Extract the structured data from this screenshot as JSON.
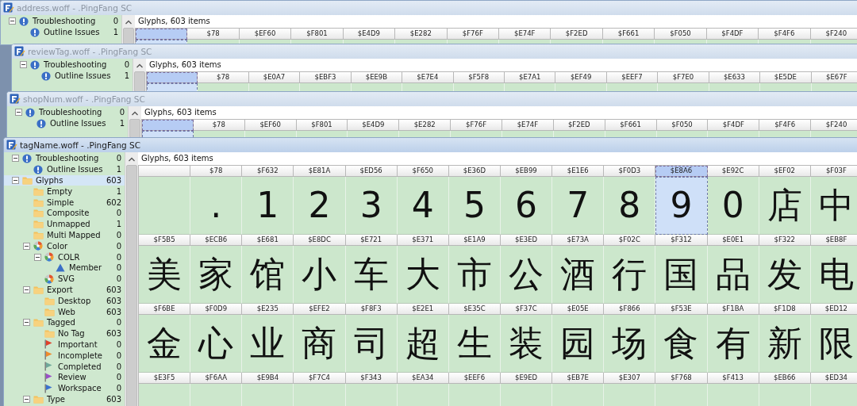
{
  "windows": [
    {
      "title": "address.woff - .PingFang SC",
      "active": false,
      "tree": [
        {
          "label": "Troubleshooting",
          "kind": "info",
          "count": "0",
          "expanded": true,
          "selected": false,
          "children": [
            {
              "label": "Outline Issues",
              "kind": "info",
              "count": "1",
              "selected": false
            }
          ]
        }
      ],
      "list_title": "Glyphs, 603 items",
      "rows": [
        {
          "cells": [
            {
              "selected": true
            },
            {
              "code": "$78",
              "selected": false
            },
            {
              "code": "$EF60",
              "selected": false
            },
            {
              "code": "$F801",
              "selected": false
            },
            {
              "code": "$E4D9",
              "selected": false
            },
            {
              "code": "$E282",
              "selected": false
            },
            {
              "code": "$F76F",
              "selected": false
            },
            {
              "code": "$E74F",
              "selected": false
            },
            {
              "code": "$F2ED",
              "selected": false
            },
            {
              "code": "$F661",
              "selected": false
            },
            {
              "code": "$F050",
              "selected": false
            },
            {
              "code": "$F4DF",
              "selected": false
            },
            {
              "code": "$F4F6",
              "selected": false
            },
            {
              "code": "$F240",
              "selected": false
            }
          ]
        }
      ]
    },
    {
      "title": "reviewTag.woff - .PingFang SC",
      "active": false,
      "tree": [
        {
          "label": "Troubleshooting",
          "kind": "info",
          "count": "0",
          "expanded": true,
          "selected": false,
          "children": [
            {
              "label": "Outline Issues",
              "kind": "info",
              "count": "1",
              "selected": false
            }
          ]
        }
      ],
      "list_title": "Glyphs, 603 items",
      "rows": [
        {
          "cells": [
            {
              "selected": true
            },
            {
              "code": "$78",
              "selected": false
            },
            {
              "code": "$E0A7",
              "selected": false
            },
            {
              "code": "$EBF3",
              "selected": false
            },
            {
              "code": "$EE9B",
              "selected": false
            },
            {
              "code": "$E7E4",
              "selected": false
            },
            {
              "code": "$F5F8",
              "selected": false
            },
            {
              "code": "$E7A1",
              "selected": false
            },
            {
              "code": "$EF49",
              "selected": false
            },
            {
              "code": "$EEF7",
              "selected": false
            },
            {
              "code": "$F7E0",
              "selected": false
            },
            {
              "code": "$E633",
              "selected": false
            },
            {
              "code": "$E5DE",
              "selected": false
            },
            {
              "code": "$E67F",
              "selected": false
            }
          ]
        }
      ]
    },
    {
      "title": "shopNum.woff - .PingFang SC",
      "active": false,
      "tree": [
        {
          "label": "Troubleshooting",
          "kind": "info",
          "count": "0",
          "expanded": true,
          "selected": false,
          "children": [
            {
              "label": "Outline Issues",
              "kind": "info",
              "count": "1",
              "selected": false
            }
          ]
        }
      ],
      "list_title": "Glyphs, 603 items",
      "rows": [
        {
          "cells": [
            {
              "selected": true
            },
            {
              "code": "$78",
              "selected": false
            },
            {
              "code": "$EF60",
              "selected": false
            },
            {
              "code": "$F801",
              "selected": false
            },
            {
              "code": "$E4D9",
              "selected": false
            },
            {
              "code": "$E282",
              "selected": false
            },
            {
              "code": "$F76F",
              "selected": false
            },
            {
              "code": "$E74F",
              "selected": false
            },
            {
              "code": "$F2ED",
              "selected": false
            },
            {
              "code": "$F661",
              "selected": false
            },
            {
              "code": "$F050",
              "selected": false
            },
            {
              "code": "$F4DF",
              "selected": false
            },
            {
              "code": "$F4F6",
              "selected": false
            },
            {
              "code": "$F240",
              "selected": false
            }
          ]
        }
      ]
    },
    {
      "title": "tagName.woff - .PingFang SC",
      "active": true,
      "tree": [
        {
          "label": "Troubleshooting",
          "kind": "info",
          "count": "0",
          "expanded": true,
          "selected": false,
          "children": [
            {
              "label": "Outline Issues",
              "kind": "info",
              "count": "1",
              "selected": false
            }
          ]
        },
        {
          "label": "Glyphs",
          "kind": "folder",
          "count": "603",
          "expanded": true,
          "selected": true,
          "children": [
            {
              "label": "Empty",
              "kind": "folder",
              "count": "1",
              "selected": false
            },
            {
              "label": "Simple",
              "kind": "folder",
              "count": "602",
              "selected": false
            },
            {
              "label": "Composite",
              "kind": "folder",
              "count": "0",
              "selected": false
            },
            {
              "label": "Unmapped",
              "kind": "folder",
              "count": "1",
              "selected": false
            },
            {
              "label": "Multi Mapped",
              "kind": "folder",
              "count": "0",
              "selected": false
            },
            {
              "label": "Color",
              "kind": "palette",
              "count": "0",
              "expanded": true,
              "selected": false,
              "children": [
                {
                  "label": "COLR",
                  "kind": "palette",
                  "count": "0",
                  "expanded": true,
                  "selected": false,
                  "children": [
                    {
                      "label": "Member",
                      "kind": "triangle",
                      "count": "0",
                      "selected": false
                    }
                  ]
                },
                {
                  "label": "SVG",
                  "kind": "palette",
                  "count": "0",
                  "selected": false
                }
              ]
            },
            {
              "label": "Export",
              "kind": "folder",
              "count": "603",
              "expanded": true,
              "selected": false,
              "children": [
                {
                  "label": "Desktop",
                  "kind": "folder",
                  "count": "603",
                  "selected": false
                },
                {
                  "label": "Web",
                  "kind": "folder",
                  "count": "603",
                  "selected": false
                }
              ]
            },
            {
              "label": "Tagged",
              "kind": "folder",
              "count": "0",
              "expanded": true,
              "selected": false,
              "children": [
                {
                  "label": "No Tag",
                  "kind": "folder",
                  "count": "603",
                  "selected": false
                },
                {
                  "label": "Important",
                  "kind": "flag",
                  "color": "#e0402a",
                  "count": "0",
                  "selected": false
                },
                {
                  "label": "Incomplete",
                  "kind": "flag",
                  "color": "#f08a2a",
                  "count": "0",
                  "selected": false
                },
                {
                  "label": "Completed",
                  "kind": "flag",
                  "color": "#6fa89a",
                  "count": "0",
                  "selected": false
                },
                {
                  "label": "Review",
                  "kind": "flag",
                  "color": "#9a4fc8",
                  "count": "0",
                  "selected": false
                },
                {
                  "label": "Workspace",
                  "kind": "flag",
                  "color": "#3a72d0",
                  "count": "0",
                  "selected": false
                }
              ]
            },
            {
              "label": "Type",
              "kind": "folder",
              "count": "603",
              "expanded": true,
              "selected": false
            }
          ]
        }
      ],
      "list_title": "Glyphs, 603 items",
      "rows": [
        {
          "cells": [
            {
              "selected": false
            },
            {
              "code": "$78",
              "glyph": ".",
              "selected": false
            },
            {
              "code": "$F632",
              "glyph": "1",
              "selected": false
            },
            {
              "code": "$E81A",
              "glyph": "2",
              "selected": false
            },
            {
              "code": "$ED56",
              "glyph": "3",
              "selected": false
            },
            {
              "code": "$F650",
              "glyph": "4",
              "selected": false
            },
            {
              "code": "$E36D",
              "glyph": "5",
              "selected": false
            },
            {
              "code": "$EB99",
              "glyph": "6",
              "selected": false
            },
            {
              "code": "$E1E6",
              "glyph": "7",
              "selected": false
            },
            {
              "code": "$F0D3",
              "glyph": "8",
              "selected": false
            },
            {
              "code": "$E8A6",
              "glyph": "9",
              "selected": true
            },
            {
              "code": "$E92C",
              "glyph": "0",
              "selected": false
            },
            {
              "code": "$EF02",
              "glyph": "店",
              "selected": false
            },
            {
              "code": "$F03F",
              "glyph": "中",
              "selected": false
            }
          ]
        },
        {
          "cells": [
            {
              "code": "$F5B5",
              "glyph": "美",
              "selected": false
            },
            {
              "code": "$ECB6",
              "glyph": "家",
              "selected": false
            },
            {
              "code": "$E681",
              "glyph": "馆",
              "selected": false
            },
            {
              "code": "$E8DC",
              "glyph": "小",
              "selected": false
            },
            {
              "code": "$E721",
              "glyph": "车",
              "selected": false
            },
            {
              "code": "$E371",
              "glyph": "大",
              "selected": false
            },
            {
              "code": "$E1A9",
              "glyph": "市",
              "selected": false
            },
            {
              "code": "$E3ED",
              "glyph": "公",
              "selected": false
            },
            {
              "code": "$E73A",
              "glyph": "酒",
              "selected": false
            },
            {
              "code": "$F02C",
              "glyph": "行",
              "selected": false
            },
            {
              "code": "$F312",
              "glyph": "国",
              "selected": false
            },
            {
              "code": "$E0E1",
              "glyph": "品",
              "selected": false
            },
            {
              "code": "$F322",
              "glyph": "发",
              "selected": false
            },
            {
              "code": "$EB8F",
              "glyph": "电",
              "selected": false
            }
          ]
        },
        {
          "cells": [
            {
              "code": "$F6BE",
              "glyph": "金",
              "selected": false
            },
            {
              "code": "$F0D9",
              "glyph": "心",
              "selected": false
            },
            {
              "code": "$E235",
              "glyph": "业",
              "selected": false
            },
            {
              "code": "$EFE2",
              "glyph": "商",
              "selected": false
            },
            {
              "code": "$F8F3",
              "glyph": "司",
              "selected": false
            },
            {
              "code": "$E2E1",
              "glyph": "超",
              "selected": false
            },
            {
              "code": "$E35C",
              "glyph": "生",
              "selected": false
            },
            {
              "code": "$F37C",
              "glyph": "装",
              "selected": false
            },
            {
              "code": "$E05E",
              "glyph": "园",
              "selected": false
            },
            {
              "code": "$F866",
              "glyph": "场",
              "selected": false
            },
            {
              "code": "$F53E",
              "glyph": "食",
              "selected": false
            },
            {
              "code": "$F1BA",
              "glyph": "有",
              "selected": false
            },
            {
              "code": "$F1D8",
              "glyph": "新",
              "selected": false
            },
            {
              "code": "$ED12",
              "glyph": "限",
              "selected": false
            }
          ]
        },
        {
          "cells": [
            {
              "code": "$E3F5",
              "selected": false
            },
            {
              "code": "$F6AA",
              "selected": false
            },
            {
              "code": "$E9B4",
              "selected": false
            },
            {
              "code": "$F7C4",
              "selected": false
            },
            {
              "code": "$F343",
              "selected": false
            },
            {
              "code": "$EA34",
              "selected": false
            },
            {
              "code": "$EEF6",
              "selected": false
            },
            {
              "code": "$E9ED",
              "selected": false
            },
            {
              "code": "$EB7E",
              "selected": false
            },
            {
              "code": "$E307",
              "selected": false
            },
            {
              "code": "$F768",
              "selected": false
            },
            {
              "code": "$F413",
              "selected": false
            },
            {
              "code": "$EB66",
              "selected": false
            },
            {
              "code": "$ED34",
              "selected": false
            }
          ]
        }
      ]
    }
  ]
}
